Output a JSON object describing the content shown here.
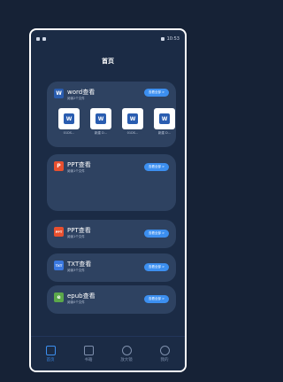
{
  "status": {
    "left": "▪▪ ᵃᵗᵃⁿᵍ ≋",
    "time": "10:53"
  },
  "page_title": "首页",
  "cards": [
    {
      "id": "word",
      "title": "word查看",
      "subtitle": "阅读2个文件",
      "action": "查看全部 >",
      "icon_color": "#2a5db0",
      "icon_text": "W",
      "files": [
        {
          "caption": "01DS..."
        },
        {
          "caption": "新建 D..."
        },
        {
          "caption": "01DS..."
        },
        {
          "caption": "新建 D..."
        }
      ]
    },
    {
      "id": "ppt1",
      "title": "PPT查看",
      "subtitle": "阅读1个文件",
      "action": "查看全部 >",
      "icon_color": "#e8502f",
      "icon_text": "P"
    },
    {
      "id": "ppt2",
      "title": "PPT查看",
      "subtitle": "阅读1个文件",
      "action": "查看全部 >",
      "icon_color": "#e8502f",
      "icon_text": "PPT"
    },
    {
      "id": "txt",
      "title": "TXT查看",
      "subtitle": "阅读3个文件",
      "action": "查看全部 >",
      "icon_color": "#3a78e0",
      "icon_text": "TXT"
    },
    {
      "id": "epub",
      "title": "epub查看",
      "subtitle": "阅读0个文件",
      "action": "查看全部 >",
      "icon_color": "#5ba84a",
      "icon_text": "e"
    }
  ],
  "tabs": [
    {
      "label": "首页"
    },
    {
      "label": "书籍"
    },
    {
      "label": "放大镜"
    },
    {
      "label": "我的"
    }
  ]
}
